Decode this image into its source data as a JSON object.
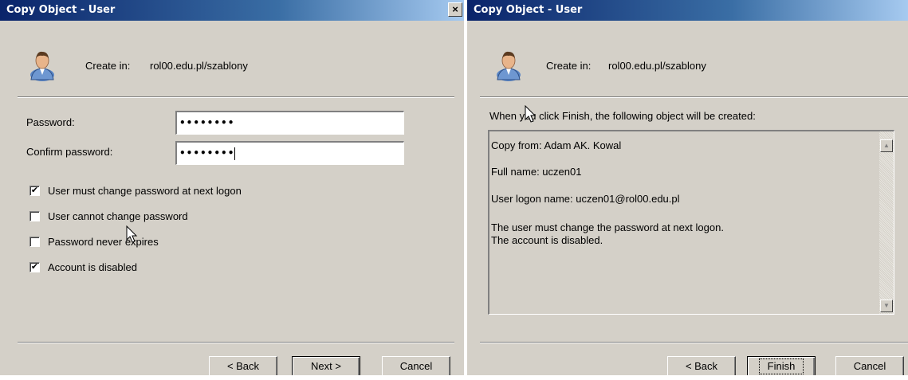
{
  "left_dialog": {
    "title": "Copy Object - User",
    "close_glyph": "×",
    "create_in_label": "Create in:",
    "create_in_value": "rol00.edu.pl/szablony",
    "password_label": "Password:",
    "password_value": "••••••••",
    "confirm_label": "Confirm password:",
    "confirm_value": "••••••••",
    "checkboxes": [
      {
        "label": "User must change password at next logon",
        "checked": true,
        "mark": "✔"
      },
      {
        "label": "User cannot change password",
        "checked": false,
        "mark": ""
      },
      {
        "label": "Password never expires",
        "checked": false,
        "mark": ""
      },
      {
        "label": "Account is disabled",
        "checked": true,
        "mark": "✔"
      }
    ],
    "buttons": {
      "back": "< Back",
      "next": "Next >",
      "cancel": "Cancel"
    }
  },
  "right_dialog": {
    "title": "Copy Object - User",
    "create_in_label": "Create in:",
    "create_in_value": "rol00.edu.pl/szablony",
    "intro": "When you click Finish, the following object will be created:",
    "summary_lines": [
      "Copy from: Adam AK. Kowal",
      "Full name: uczen01",
      "User logon name: uczen01@rol00.edu.pl",
      "The user must change the password at next logon.",
      "The account is disabled."
    ],
    "buttons": {
      "back": "< Back",
      "finish": "Finish",
      "cancel": "Cancel"
    }
  },
  "colors": {
    "dialog_bg": "#d4d0c8",
    "title_start": "#0a246a",
    "title_end": "#a6caf0"
  },
  "icons": [
    "user-icon",
    "close-icon",
    "mouse-cursor-icon",
    "scroll-up-icon",
    "scroll-down-icon"
  ]
}
